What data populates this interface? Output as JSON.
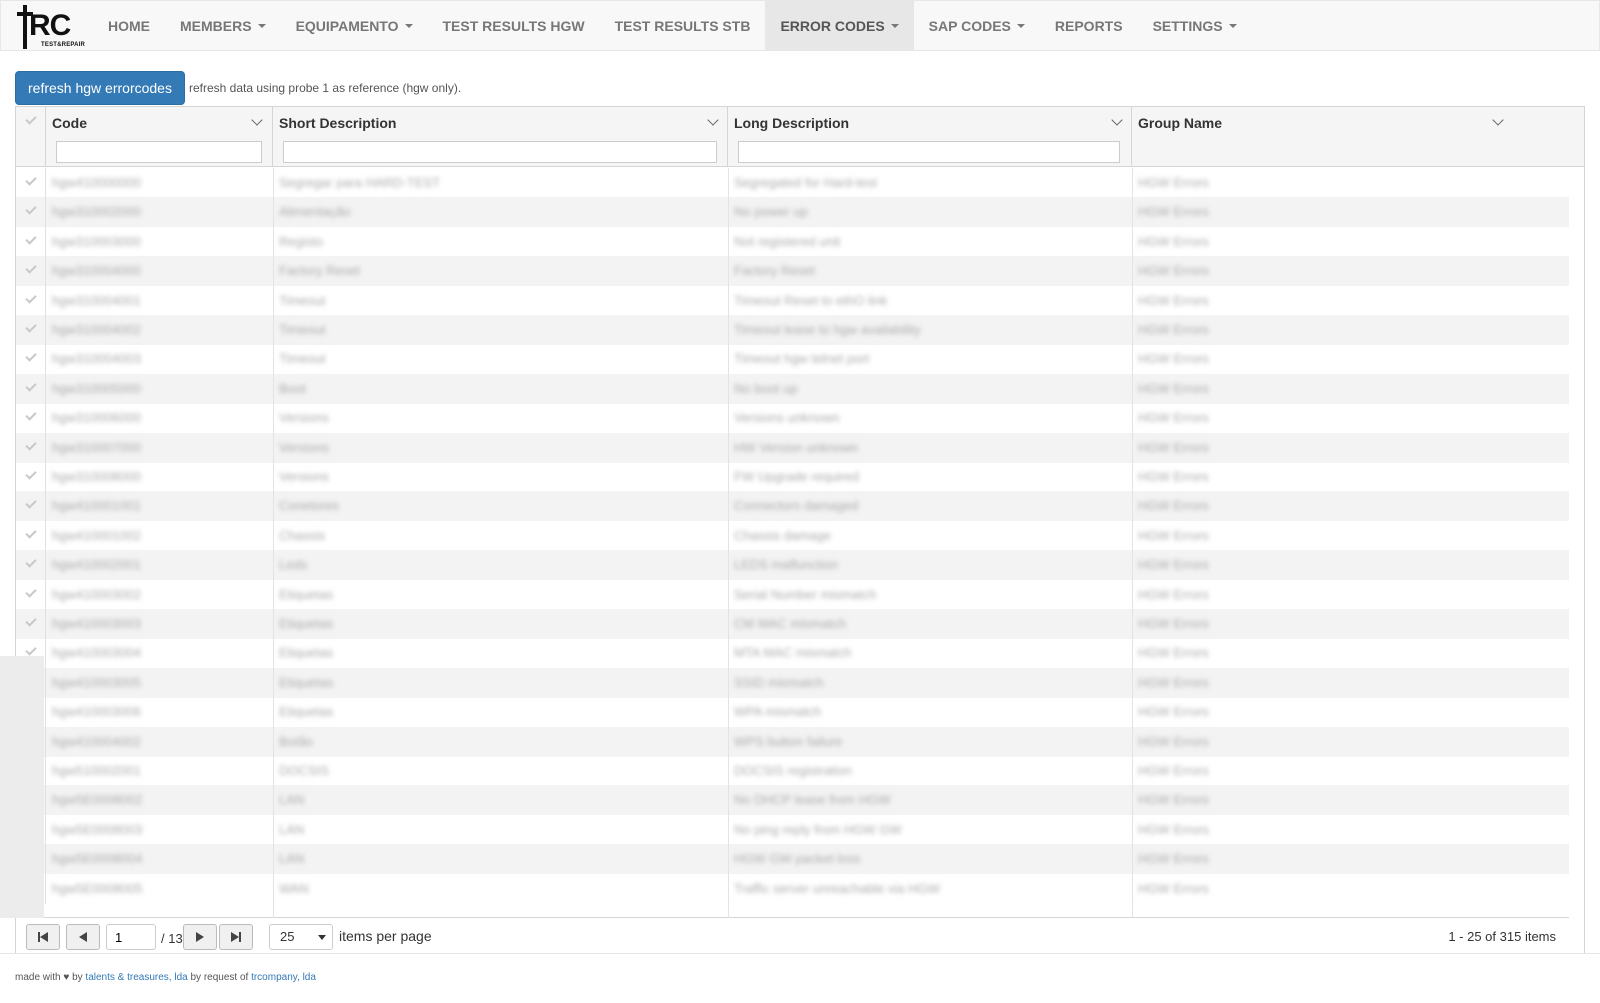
{
  "brand": {
    "logo_text": "RC",
    "logo_sub": "TEST&REPAIR"
  },
  "nav": [
    {
      "label": "HOME",
      "dropdown": false,
      "active": false
    },
    {
      "label": "MEMBERS",
      "dropdown": true,
      "active": false
    },
    {
      "label": "EQUIPAMENTO",
      "dropdown": true,
      "active": false
    },
    {
      "label": "TEST RESULTS HGW",
      "dropdown": false,
      "active": false
    },
    {
      "label": "TEST RESULTS STB",
      "dropdown": false,
      "active": false
    },
    {
      "label": "ERROR CODES",
      "dropdown": true,
      "active": true
    },
    {
      "label": "SAP CODES",
      "dropdown": true,
      "active": false
    },
    {
      "label": "REPORTS",
      "dropdown": false,
      "active": false
    },
    {
      "label": "SETTINGS",
      "dropdown": true,
      "active": false
    }
  ],
  "toolbar": {
    "refresh_label": "refresh hgw errorcodes",
    "note": "refresh data using probe 1 as reference (hgw only)."
  },
  "grid": {
    "columns": [
      "Code",
      "Short Description",
      "Long Description",
      "Group Name"
    ],
    "rows": [
      [
        "hgw410000000",
        "Segregar para HARD-TEST",
        "Segregated for Hard-test",
        "HGW Errors"
      ],
      [
        "hgw310002000",
        "Alimentação",
        "No power up",
        "HGW Errors"
      ],
      [
        "hgw310003000",
        "Registo",
        "Not registered unit",
        "HGW Errors"
      ],
      [
        "hgw310004000",
        "Factory Reset",
        "Factory Reset",
        "HGW Errors"
      ],
      [
        "hgw310004001",
        "Timeout",
        "Timeout Reset to ethO link",
        "HGW Errors"
      ],
      [
        "hgw310004002",
        "Timeout",
        "Timeout lease to hgw availability",
        "HGW Errors"
      ],
      [
        "hgw310004003",
        "Timeout",
        "Timeout hgw telnet port",
        "HGW Errors"
      ],
      [
        "hgw310005000",
        "Boot",
        "No boot up",
        "HGW Errors"
      ],
      [
        "hgw310006000",
        "Versions",
        "Versions unknown",
        "HGW Errors"
      ],
      [
        "hgw310007000",
        "Versions",
        "HW Version unknown",
        "HGW Errors"
      ],
      [
        "hgw310008000",
        "Versions",
        "FW Upgrade required",
        "HGW Errors"
      ],
      [
        "hgw410001001",
        "Conetores",
        "Connectors damaged",
        "HGW Errors"
      ],
      [
        "hgw410001002",
        "Chassis",
        "Chassis damage",
        "HGW Errors"
      ],
      [
        "hgw410002001",
        "Leds",
        "LEDS malfunction",
        "HGW Errors"
      ],
      [
        "hgw410003002",
        "Etiquetas",
        "Serial Number mismatch",
        "HGW Errors"
      ],
      [
        "hgw410003003",
        "Etiquetas",
        "CM MAC mismatch",
        "HGW Errors"
      ],
      [
        "hgw410003004",
        "Etiquetas",
        "MTA MAC mismatch",
        "HGW Errors"
      ],
      [
        "hgw410003005",
        "Etiquetas",
        "SSID mismatch",
        "HGW Errors"
      ],
      [
        "hgw410003006",
        "Etiquetas",
        "WPA mismatch",
        "HGW Errors"
      ],
      [
        "hgw410004002",
        "Botão",
        "WPS button failure",
        "HGW Errors"
      ],
      [
        "hgw510002001",
        "DOCSIS",
        "DOCSIS registration",
        "HGW Errors"
      ],
      [
        "hgw5E0008002",
        "LAN",
        "No DHCP lease from HGW",
        "HGW Errors"
      ],
      [
        "hgw5E0008003",
        "LAN",
        "No ping reply from HGW GW",
        "HGW Errors"
      ],
      [
        "hgw5E0008004",
        "LAN",
        "HGW GW packet loss",
        "HGW Errors"
      ],
      [
        "hgw5E0008005",
        "WAN",
        "Traffic server unreachable via HGW",
        "HGW Errors"
      ]
    ]
  },
  "pager": {
    "current_page": "1",
    "total_pages": "/ 13",
    "page_size": "25",
    "page_size_label": "items per page",
    "items_info": "1 - 25 of 315 items"
  },
  "footer": {
    "made_with": "made with",
    "heart": "♥",
    "by": "by",
    "company_link": "talents & treasures, lda",
    "by_request": "by request of",
    "client_link": "trcompany, lda"
  },
  "icons": {
    "check": "check-icon",
    "sort": "chevron-down-icon",
    "first": "first-page-icon",
    "prev": "prev-page-icon",
    "next": "next-page-icon",
    "last": "last-page-icon"
  },
  "colors": {
    "primary": "#337ab7",
    "navbar_bg": "#f8f8f8",
    "active_tab": "#e7e7e7"
  }
}
